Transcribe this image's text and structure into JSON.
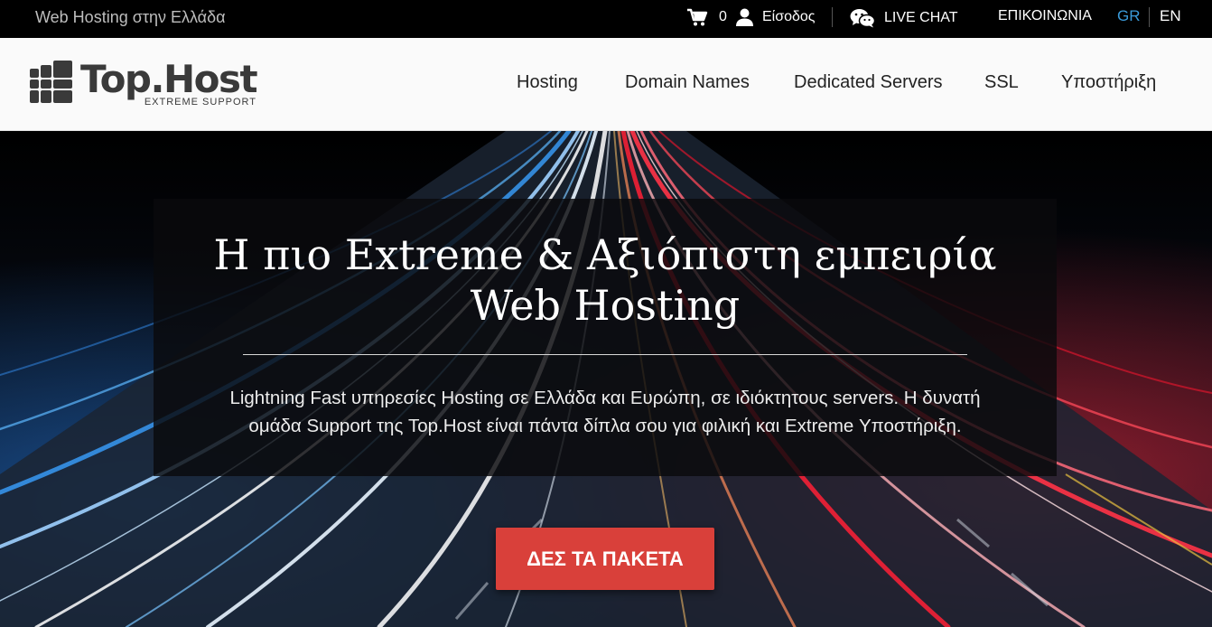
{
  "topbar": {
    "tagline": "Web Hosting στην Ελλάδα",
    "cart_count": "0",
    "login_label": "Είσοδος",
    "live_chat_label": "LIVE CHAT",
    "contact_label": "ΕΠΙΚΟΙΝΩΝΙΑ",
    "lang_gr": "GR",
    "lang_en": "EN",
    "active_lang_color": "#3a9ad9"
  },
  "header": {
    "logo_name": "Top.Host",
    "logo_tagline": "EXTREME SUPPORT",
    "nav": {
      "hosting": "Hosting",
      "domains": "Domain Names",
      "dedicated": "Dedicated Servers",
      "ssl": "SSL",
      "support": "Υποστήριξη"
    }
  },
  "hero": {
    "title_line1": "Η πιο Extreme & Αξιόπιστη εμπειρία",
    "title_line2": "Web Hosting",
    "description_line1": "Lightning Fast υπηρεσίες Hosting σε Ελλάδα και Ευρώπη, σε ιδιόκτητους servers. Η δυνατή",
    "description_line2": "ομάδα Support της Top.Host είναι πάντα δίπλα σου για φιλική και Extreme Υποστήριξη.",
    "cta_label": "ΔΕΣ ΤΑ ΠΑΚΕΤΑ",
    "cta_color": "#d9403a"
  },
  "icons": {
    "cart": "cart-icon",
    "user": "user-icon",
    "chat": "wechat-icon",
    "logo": "logo-grid-icon"
  }
}
